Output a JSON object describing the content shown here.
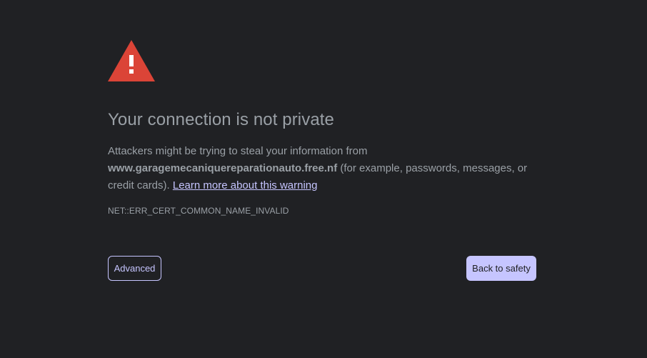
{
  "interstitial": {
    "title": "Your connection is not private",
    "description_prefix": "Attackers might be trying to steal your information from ",
    "domain": "www.garagemecaniquereparationauto.free.nf",
    "description_suffix": " (for example, passwords, messages, or credit cards). ",
    "learn_more_link": "Learn more about this warning",
    "error_code": "NET::ERR_CERT_COMMON_NAME_INVALID"
  },
  "buttons": {
    "advanced": "Advanced",
    "back_to_safety": "Back to safety"
  },
  "colors": {
    "background": "#202124",
    "text": "#9aa0a6",
    "accent": "#c6c5ff",
    "warning_red": "#db4437"
  },
  "icons": {
    "warning": "warning-triangle-icon"
  }
}
